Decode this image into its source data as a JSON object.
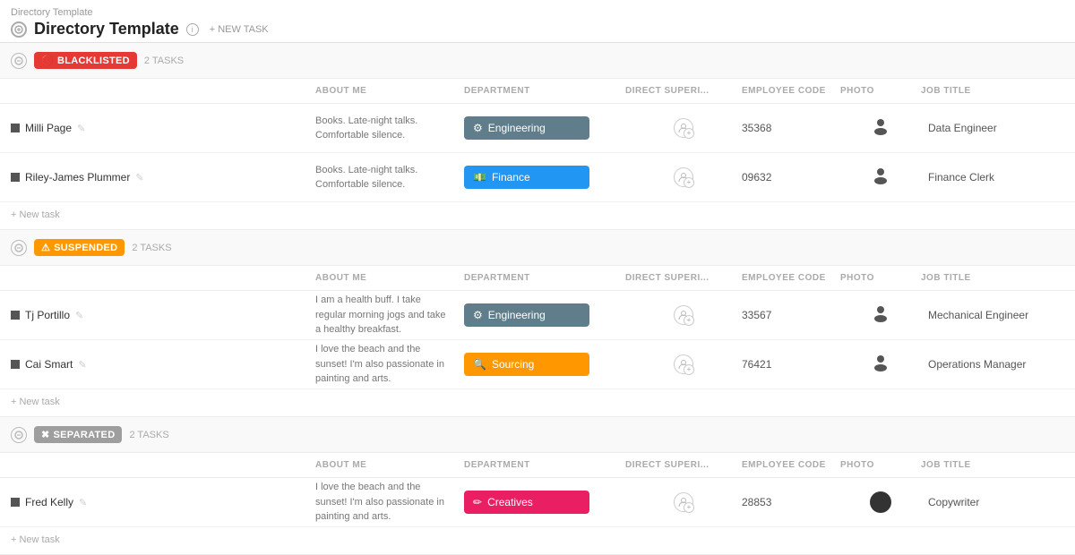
{
  "app": {
    "breadcrumb": "Directory Template",
    "title": "Directory Template",
    "info_label": "i",
    "new_task_label": "+ NEW TASK"
  },
  "sections": [
    {
      "id": "blacklisted",
      "badge_label": "BLACKLISTED",
      "badge_class": "badge-blacklisted",
      "badge_emoji": "🚫",
      "task_count": "2 TASKS",
      "columns": [
        "",
        "ABOUT ME",
        "DEPARTMENT",
        "DIRECT SUPERI...",
        "EMPLOYEE CODE",
        "PHOTO",
        "JOB TITLE"
      ],
      "rows": [
        {
          "name": "Milli Page",
          "about": "Books. Late-night talks. Comfortable silence.",
          "dept_label": "Engineering",
          "dept_class": "dept-engineering",
          "dept_emoji": "⚙",
          "supervisor_plus": true,
          "emp_code": "35368",
          "has_avatar": true,
          "avatar_filled": false,
          "job_title": "Data Engineer"
        },
        {
          "name": "Riley-James Plummer",
          "about": "Books. Late-night talks. Comfortable silence.",
          "dept_label": "Finance",
          "dept_class": "dept-finance",
          "dept_emoji": "💵",
          "supervisor_plus": true,
          "emp_code": "09632",
          "has_avatar": true,
          "avatar_filled": false,
          "job_title": "Finance Clerk"
        }
      ],
      "new_task_label": "+ New task"
    },
    {
      "id": "suspended",
      "badge_label": "SUSPENDED",
      "badge_class": "badge-suspended",
      "badge_emoji": "⚠",
      "task_count": "2 TASKS",
      "columns": [
        "",
        "ABOUT ME",
        "DEPARTMENT",
        "DIRECT SUPERI...",
        "EMPLOYEE CODE",
        "PHOTO",
        "JOB TITLE"
      ],
      "rows": [
        {
          "name": "Tj Portillo",
          "about": "I am a health buff. I take regular morning jogs and take a healthy breakfast.",
          "dept_label": "Engineering",
          "dept_class": "dept-engineering",
          "dept_emoji": "⚙",
          "supervisor_plus": true,
          "emp_code": "33567",
          "has_avatar": true,
          "avatar_filled": false,
          "job_title": "Mechanical Engineer"
        },
        {
          "name": "Cai Smart",
          "about": "I love the beach and the sunset! I'm also passionate in painting and arts.",
          "dept_label": "Sourcing",
          "dept_class": "dept-sourcing",
          "dept_emoji": "🔍",
          "supervisor_plus": true,
          "emp_code": "76421",
          "has_avatar": true,
          "avatar_filled": false,
          "job_title": "Operations Manager"
        }
      ],
      "new_task_label": "+ New task"
    },
    {
      "id": "separated",
      "badge_label": "SEPARATED",
      "badge_class": "badge-separated",
      "badge_emoji": "✖",
      "task_count": "2 TASKS",
      "columns": [
        "",
        "ABOUT ME",
        "DEPARTMENT",
        "DIRECT SUPERI...",
        "EMPLOYEE CODE",
        "PHOTO",
        "JOB TITLE"
      ],
      "rows": [
        {
          "name": "Fred Kelly",
          "about": "I love the beach and the sunset! I'm also passionate in painting and arts.",
          "dept_label": "Creatives",
          "dept_class": "dept-creatives",
          "dept_emoji": "✏",
          "supervisor_plus": true,
          "emp_code": "28853",
          "has_avatar": true,
          "avatar_filled": true,
          "job_title": "Copywriter"
        }
      ],
      "new_task_label": "+ New task"
    }
  ]
}
